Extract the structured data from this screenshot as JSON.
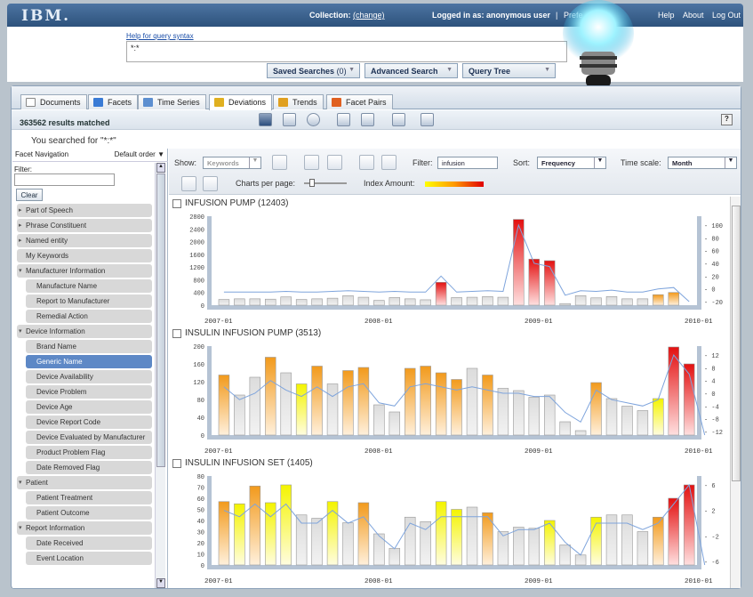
{
  "topbar": {
    "logo": "IBM.",
    "collection_label": "Collection:",
    "change": "(change)",
    "logged_in": "Logged in as: anonymous user",
    "sep": "|",
    "prefs": "Prefe",
    "help": "Help",
    "about": "About",
    "logout": "Log Out"
  },
  "query": {
    "help_link": "Help for query syntax",
    "value": "*:*",
    "saved_searches": "Saved Searches",
    "saved_count": "(0)",
    "advanced_search": "Advanced Search",
    "query_tree": "Query Tree"
  },
  "tabs": [
    {
      "label": "Documents",
      "color": "#ffffff"
    },
    {
      "label": "Facets",
      "color": "#3a7bd5"
    },
    {
      "label": "Time Series",
      "color": "#5d8fd0"
    },
    {
      "label": "Deviations",
      "color": "#e0b020"
    },
    {
      "label": "Trends",
      "color": "#e0a020"
    },
    {
      "label": "Facet Pairs",
      "color": "#e06020"
    }
  ],
  "results": {
    "text": "363562 results matched",
    "searched": "You searched for \"*:*\""
  },
  "sidebar": {
    "header": "Facet Navigation",
    "order": "Default order",
    "filter_label": "Filter:",
    "clear": "Clear",
    "items": [
      {
        "label": "Part of Speech",
        "type": "cat"
      },
      {
        "label": "Phrase Constituent",
        "type": "cat"
      },
      {
        "label": "Named entity",
        "type": "cat"
      },
      {
        "label": "My Keywords",
        "type": "plain"
      },
      {
        "label": "Manufacturer Information",
        "type": "open"
      },
      {
        "label": "Manufacture Name",
        "type": "sub"
      },
      {
        "label": "Report to Manufacturer",
        "type": "sub"
      },
      {
        "label": "Remedial Action",
        "type": "sub"
      },
      {
        "label": "Device Information",
        "type": "open"
      },
      {
        "label": "Brand Name",
        "type": "sub"
      },
      {
        "label": "Generic Name",
        "type": "sub-sel"
      },
      {
        "label": "Device Availability",
        "type": "sub"
      },
      {
        "label": "Device Problem",
        "type": "sub"
      },
      {
        "label": "Device Age",
        "type": "sub"
      },
      {
        "label": "Device Report Code",
        "type": "sub"
      },
      {
        "label": "Device Evaluated by Manufacturer",
        "type": "sub"
      },
      {
        "label": "Product Problem Flag",
        "type": "sub"
      },
      {
        "label": "Date Removed Flag",
        "type": "sub"
      },
      {
        "label": "Patient",
        "type": "open"
      },
      {
        "label": "Patient Treatment",
        "type": "sub"
      },
      {
        "label": "Patient Outcome",
        "type": "sub"
      },
      {
        "label": "Report Information",
        "type": "open"
      },
      {
        "label": "Date Received",
        "type": "sub"
      },
      {
        "label": "Event Location",
        "type": "sub"
      }
    ]
  },
  "controls": {
    "show_label": "Show:",
    "show_value": "Keywords",
    "filter_label": "Filter:",
    "filter_value": "infusion",
    "sort_label": "Sort:",
    "sort_value": "Frequency",
    "timescale_label": "Time scale:",
    "timescale_value": "Month",
    "charts_per_page": "Charts per page:",
    "index_amount": "Index Amount:"
  },
  "chart_data": [
    {
      "type": "bar",
      "title": "INFUSION PUMP (12403)",
      "x_ticks": [
        "2007-01",
        "2008-01",
        "2009-01",
        "2010-01"
      ],
      "ylim": [
        0,
        2800
      ],
      "yticks": [
        0,
        400,
        800,
        1200,
        1600,
        2000,
        2400,
        2800
      ],
      "y2ticks": [
        -20,
        0,
        20,
        40,
        60,
        80,
        100
      ],
      "values": [
        180,
        200,
        200,
        190,
        260,
        180,
        200,
        220,
        300,
        250,
        150,
        240,
        200,
        170,
        720,
        240,
        250,
        270,
        250,
        2700,
        1450,
        1400,
        50,
        300,
        230,
        270,
        200,
        200,
        330,
        400
      ],
      "colors": [
        "g",
        "g",
        "g",
        "g",
        "g",
        "g",
        "g",
        "g",
        "g",
        "g",
        "g",
        "g",
        "g",
        "g",
        "r",
        "g",
        "g",
        "g",
        "g",
        "r",
        "r",
        "r",
        "g",
        "g",
        "g",
        "g",
        "g",
        "g",
        "o",
        "o"
      ],
      "line": [
        -5,
        -5,
        -5,
        -5,
        -4,
        -5,
        -5,
        -4,
        -3,
        -4,
        -5,
        -4,
        -5,
        -5,
        20,
        -5,
        -4,
        -3,
        -4,
        100,
        40,
        35,
        -10,
        -3,
        -4,
        -2,
        -5,
        -5,
        0,
        2,
        -20
      ]
    },
    {
      "type": "bar",
      "title": "INSULIN INFUSION PUMP (3513)",
      "x_ticks": [
        "2007-01",
        "2008-01",
        "2009-01",
        "2010-01"
      ],
      "ylim": [
        0,
        200
      ],
      "yticks": [
        0,
        40,
        80,
        120,
        160,
        200
      ],
      "y2ticks": [
        -12,
        -8,
        -4,
        0,
        4,
        8,
        12
      ],
      "values": [
        135,
        90,
        130,
        175,
        140,
        115,
        155,
        115,
        145,
        152,
        68,
        52,
        150,
        155,
        140,
        125,
        150,
        135,
        105,
        100,
        85,
        90,
        30,
        10,
        118,
        82,
        65,
        55,
        82,
        198,
        160
      ],
      "colors": [
        "o",
        "g",
        "g",
        "o",
        "g",
        "y",
        "o",
        "g",
        "o",
        "o",
        "g",
        "g",
        "o",
        "o",
        "o",
        "o",
        "g",
        "o",
        "g",
        "g",
        "g",
        "g",
        "g",
        "g",
        "o",
        "g",
        "g",
        "g",
        "y",
        "r",
        "r"
      ],
      "line": [
        2,
        -2,
        0,
        4,
        1,
        -1,
        2,
        -1,
        2,
        3,
        -3,
        -4,
        2,
        3,
        2,
        1,
        2,
        1,
        0,
        0,
        -1,
        -1,
        -6,
        -9,
        1,
        -2,
        -3,
        -4,
        -2,
        12,
        6,
        -14
      ]
    },
    {
      "type": "bar",
      "title": "INSULIN INFUSION SET (1405)",
      "x_ticks": [
        "2007-01",
        "2008-01",
        "2009-01",
        "2010-01"
      ],
      "ylim": [
        0,
        80
      ],
      "yticks": [
        0,
        10,
        20,
        30,
        40,
        50,
        60,
        70,
        80
      ],
      "y2ticks": [
        -6,
        -2,
        2,
        6
      ],
      "values": [
        57,
        55,
        71,
        56,
        72,
        45,
        42,
        57,
        38,
        56,
        28,
        15,
        43,
        39,
        57,
        50,
        52,
        47,
        30,
        34,
        33,
        40,
        18,
        9,
        43,
        45,
        45,
        30,
        43,
        60,
        72
      ],
      "colors": [
        "o",
        "y",
        "o",
        "y",
        "y",
        "g",
        "g",
        "y",
        "g",
        "o",
        "g",
        "g",
        "g",
        "g",
        "y",
        "y",
        "g",
        "o",
        "g",
        "g",
        "g",
        "y",
        "g",
        "g",
        "y",
        "g",
        "g",
        "g",
        "o",
        "r",
        "r"
      ],
      "line": [
        2,
        1,
        3,
        1,
        3,
        0,
        0,
        2,
        0,
        1,
        -2,
        -4,
        0,
        -1,
        1,
        1,
        1,
        1,
        -2,
        -1,
        -1,
        0,
        -3,
        -5,
        0,
        0,
        0,
        -1,
        0,
        3,
        6,
        -12
      ]
    }
  ],
  "colors": {
    "gray": "#dcdcdc",
    "yellow": "#f4f400",
    "orange": "#f29a1c",
    "red": "#e31010",
    "axis": "#b5c3d4",
    "line": "#7ea4dc"
  }
}
